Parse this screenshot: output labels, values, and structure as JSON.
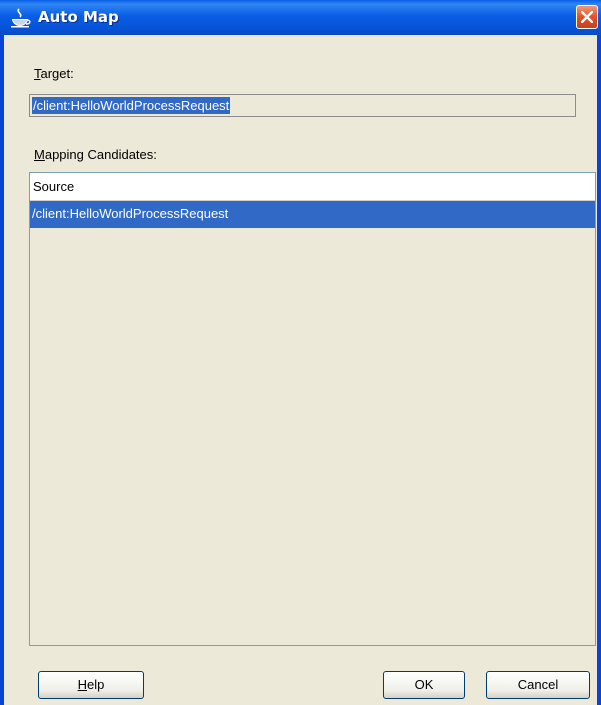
{
  "window": {
    "title": "Auto Map"
  },
  "target": {
    "label_accel": "T",
    "label_rest": "arget:",
    "value": "/client:HelloWorldProcessRequest"
  },
  "candidates": {
    "label_accel": "M",
    "label_rest": "apping Candidates:",
    "column_header": "Source",
    "rows": [
      {
        "source": "/client:HelloWorldProcessRequest",
        "selected": true
      }
    ]
  },
  "buttons": {
    "help_accel": "H",
    "help_rest": "elp",
    "ok": "OK",
    "cancel": "Cancel"
  },
  "colors": {
    "titlebar": "#0a5fe8",
    "selection": "#3169c6",
    "dialog_bg": "#ece9d8",
    "close_button": "#e2512a"
  },
  "icons": {
    "title": "jdeveloper-cup-icon",
    "close": "close-icon"
  }
}
